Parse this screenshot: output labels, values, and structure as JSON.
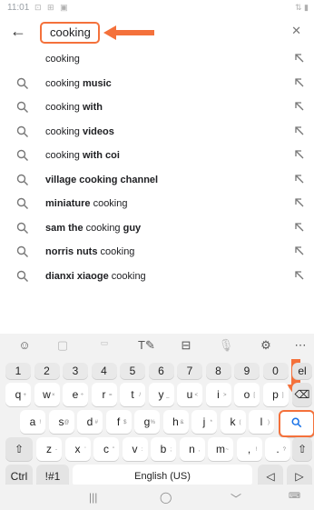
{
  "status": {
    "time": "11:01",
    "icons": "⊡ ⊞ ▣",
    "right": "⇅ ▮"
  },
  "search": {
    "query": "cooking",
    "clear_icon": "close-icon"
  },
  "suggestions": [
    {
      "pre": "cooking",
      "bold": "",
      "post": "",
      "icon": false
    },
    {
      "pre": "cooking ",
      "bold": "music",
      "post": "",
      "icon": true
    },
    {
      "pre": "cooking ",
      "bold": "with",
      "post": "",
      "icon": true
    },
    {
      "pre": "cooking ",
      "bold": "videos",
      "post": "",
      "icon": true
    },
    {
      "pre": "cooking ",
      "bold": "with coi",
      "post": "",
      "icon": true
    },
    {
      "pre": "",
      "bold": "village",
      "post": " cooking channel",
      "icon": true,
      "bold_post": true
    },
    {
      "pre": "",
      "bold": "miniature",
      "post": " cooking",
      "icon": true
    },
    {
      "pre": "",
      "bold": "sam the",
      "post": " cooking ",
      "bold2": "guy",
      "icon": true
    },
    {
      "pre": "",
      "bold": "norris nuts",
      "post": " cooking",
      "icon": true
    },
    {
      "pre": "",
      "bold": "dianxi xiaoge",
      "post": " cooking",
      "icon": true
    }
  ],
  "keyboard": {
    "numbers": [
      "1",
      "2",
      "3",
      "4",
      "5",
      "6",
      "7",
      "8",
      "9",
      "0"
    ],
    "row1": [
      [
        "q",
        "+"
      ],
      [
        "w",
        "×"
      ],
      [
        "e",
        "÷"
      ],
      [
        "r",
        "="
      ],
      [
        "t",
        "/"
      ],
      [
        "y",
        "_"
      ],
      [
        "u",
        "<"
      ],
      [
        "i",
        ">"
      ],
      [
        "o",
        "["
      ],
      [
        "p",
        "]"
      ]
    ],
    "row2": [
      [
        "a",
        "!"
      ],
      [
        "s",
        "@"
      ],
      [
        "d",
        "#"
      ],
      [
        "f",
        "$"
      ],
      [
        "g",
        "%"
      ],
      [
        "h",
        "&"
      ],
      [
        "j",
        "*"
      ],
      [
        "k",
        "("
      ],
      [
        "l",
        ")"
      ]
    ],
    "row3": [
      [
        "z",
        "-"
      ],
      [
        "x",
        "'"
      ],
      [
        "c",
        "\""
      ],
      [
        "v",
        ":"
      ],
      [
        "b",
        ";"
      ],
      [
        "n",
        ","
      ],
      [
        "m",
        "~"
      ],
      [
        ",",
        "!"
      ],
      [
        ".",
        "?"
      ]
    ],
    "del_label": "el",
    "ctrl_label": "Ctrl",
    "sym_label": "!#1",
    "space_label": "English (US)"
  },
  "colors": {
    "accent": "#f4713b",
    "search_key": "#1a73e8"
  }
}
